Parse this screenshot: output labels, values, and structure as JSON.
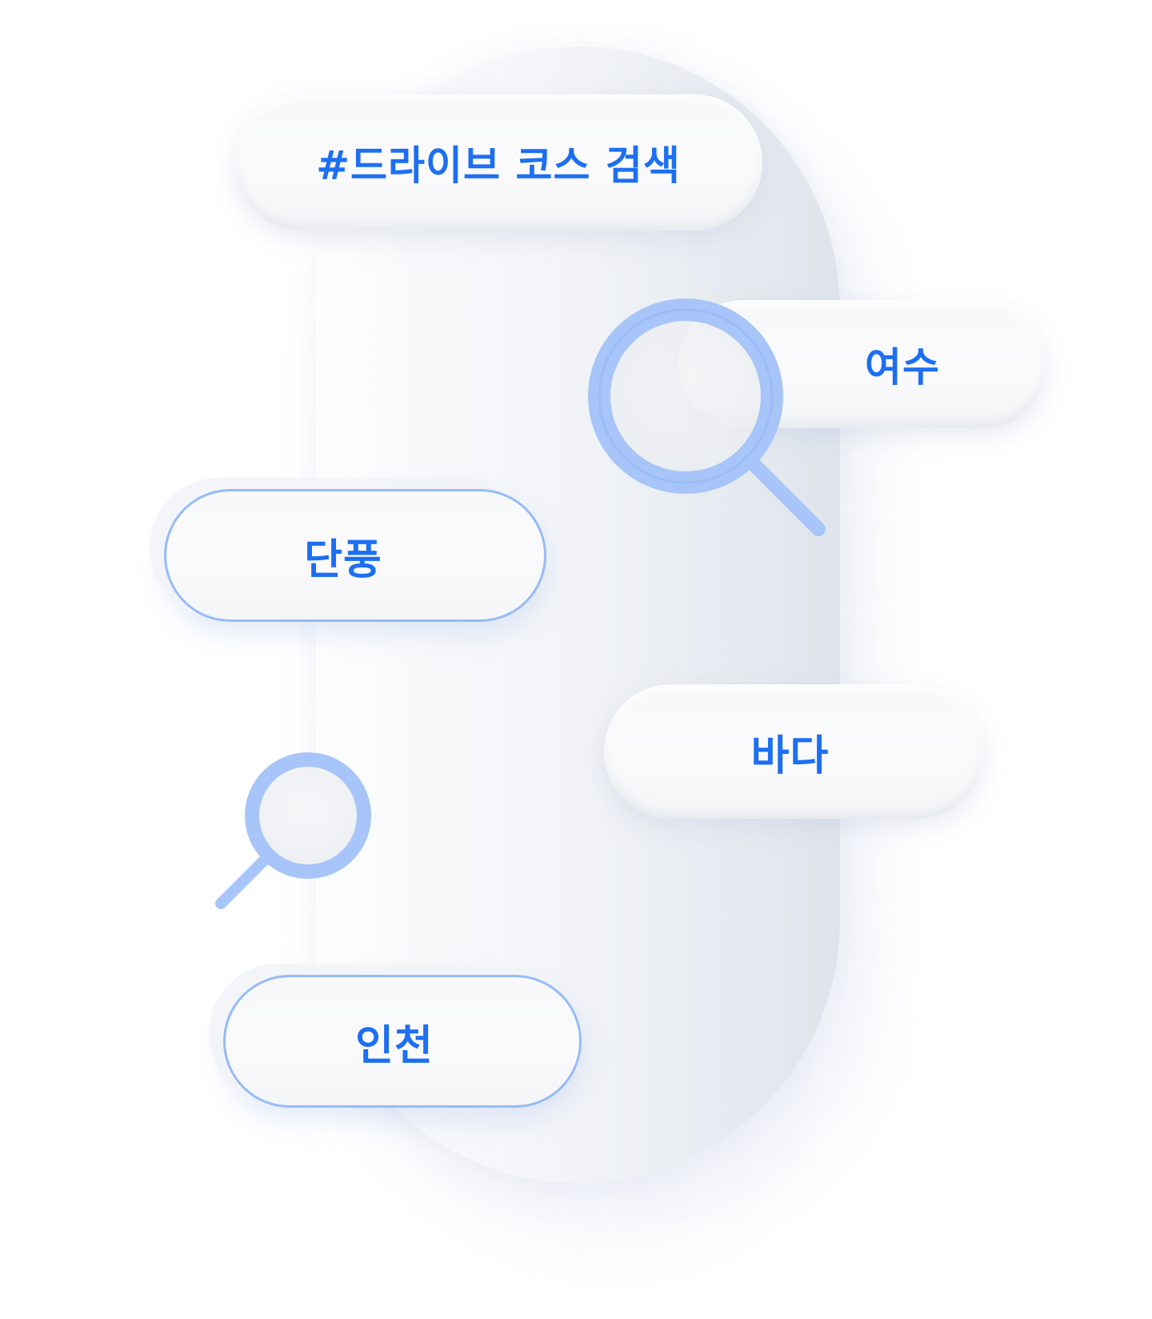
{
  "title_tag": "#드라이브 코스 검색",
  "keywords": {
    "yeosu": "여수",
    "danpung": "단풍",
    "bada": "바다",
    "incheon": "인천"
  },
  "colors": {
    "text_accent": "#1d6ff2",
    "outline": "#96bbf6",
    "magnifier": "#9fc0f7"
  },
  "icons": {
    "large": "magnifier-icon",
    "small": "magnifier-icon"
  }
}
